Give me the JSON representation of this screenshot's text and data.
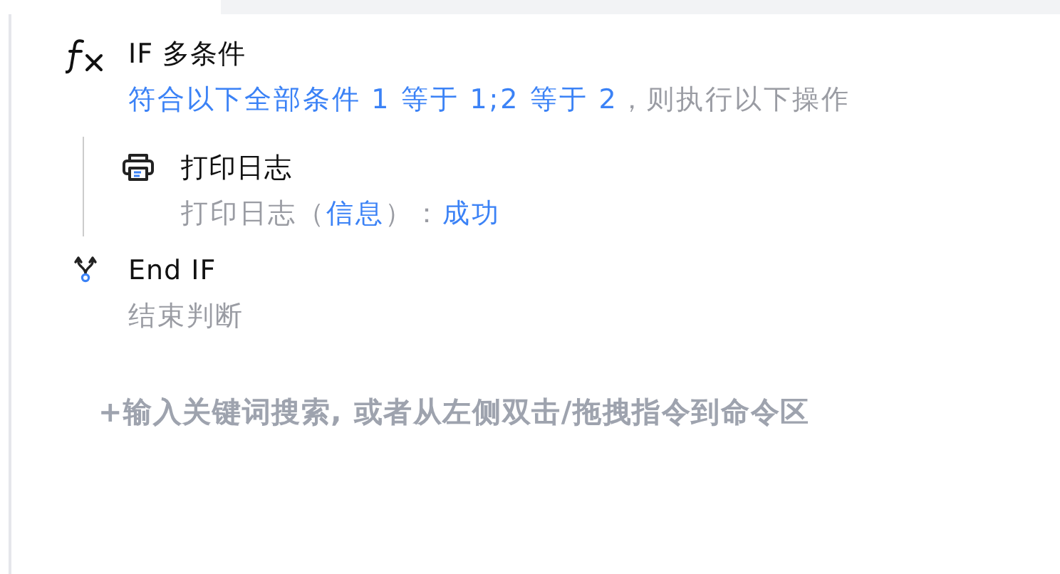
{
  "steps": [
    {
      "kind": "if",
      "title": "IF 多条件",
      "summary": [
        {
          "text": "符合以下全部条件 1 等于 1;2 等于 2",
          "highlight": true
        },
        {
          "text": "，则执行以下操作",
          "highlight": false
        }
      ],
      "children": [
        {
          "kind": "print",
          "title": "打印日志",
          "summary": [
            {
              "text": "打印日志（",
              "highlight": false
            },
            {
              "text": "信息",
              "highlight": true
            },
            {
              "text": "）：",
              "highlight": false
            },
            {
              "text": "成功",
              "highlight": true
            }
          ]
        }
      ]
    },
    {
      "kind": "endif",
      "title": "End IF",
      "summary": [
        {
          "text": "结束判断",
          "highlight": false
        }
      ]
    }
  ],
  "add_hint": "+输入关键词搜索, 或者从左侧双击/拖拽指令到命令区"
}
